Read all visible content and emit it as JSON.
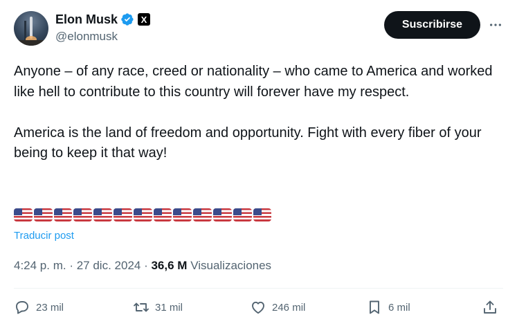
{
  "author": {
    "name": "Elon Musk",
    "handle": "@elonmusk",
    "verified_icon": "verified-badge-icon",
    "affiliation_badge": "X"
  },
  "header": {
    "subscribe_label": "Suscribirse",
    "more_icon": "more-options-icon"
  },
  "tweet": {
    "paragraph1": "Anyone – of any race, creed or nationality – who came to America and worked like hell to contribute to this country will forever have my respect.",
    "paragraph2": "America is the land of freedom and opportunity. Fight with every fiber of your being to keep it that way!",
    "flag_emoji_count": 13,
    "flag_emoji_name": "us-flag-icon"
  },
  "translate_label": "Traducir post",
  "meta": {
    "time": "4:24 p. m.",
    "separator": " · ",
    "date": "27 dic. 2024",
    "views_count": "36,6 M",
    "views_label": "Visualizaciones"
  },
  "actions": {
    "replies": "23 mil",
    "reposts": "31 mil",
    "likes": "246 mil",
    "bookmarks": "6 mil"
  },
  "colors": {
    "text": "#0f1419",
    "secondary": "#536471",
    "link": "#1d9bf0",
    "verified": "#1d9bf0",
    "button_bg": "#0f1419"
  }
}
